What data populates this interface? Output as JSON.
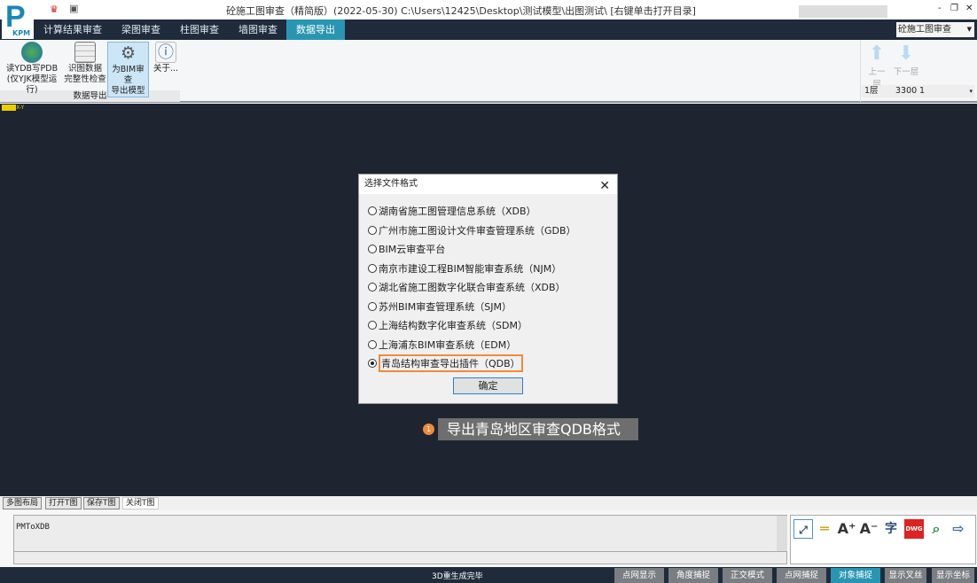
{
  "window": {
    "title": "砼施工图审查（精简版）(2022-05-30) C:\\Users\\12425\\Desktop\\测试模型\\出图测试\\ [右键单击打开目录]",
    "logo_text": "P KPM",
    "minimize": "-",
    "restore": "❐",
    "close": "✕"
  },
  "tabs": [
    {
      "label": "计算结果审查"
    },
    {
      "label": "梁图审查"
    },
    {
      "label": "柱图审查"
    },
    {
      "label": "墙图审查"
    },
    {
      "label": "数据导出",
      "active": true
    }
  ],
  "mode_select": {
    "value": "砼施工图审查"
  },
  "ribbon": {
    "buttons": [
      {
        "label1": "读YDB写PDB",
        "label2": "(仅YJK模型运行)",
        "icon": "globe-icon"
      },
      {
        "label1": "识图数据",
        "label2": "完整性检查",
        "icon": "table-icon"
      },
      {
        "label1": "为BIM审查",
        "label2": "导出模型",
        "icon": "export-gear-icon",
        "selected": true
      },
      {
        "label1": "关于...",
        "label2": "",
        "icon": "info-icon"
      }
    ],
    "group_label": "数据导出",
    "floor_up": "上一层",
    "floor_down": "下一层",
    "floor": {
      "name": "1层",
      "height": "3300",
      "index": "1"
    }
  },
  "canvas": {
    "axis_label": "X-Y"
  },
  "dialog": {
    "title": "选择文件格式",
    "options": [
      "湖南省施工图管理信息系统（XDB）",
      "广州市施工图设计文件审查管理系统（GDB）",
      "BIM云审查平台",
      "南京市建设工程BIM智能审查系统（NJM）",
      "湖北省施工图数字化联合审查系统（XDB）",
      "苏州BIM审查管理系统（SJM）",
      "上海结构数字化审查系统（SDM）",
      "上海浦东BIM审查系统（EDM）",
      "青岛结构审查导出插件（QDB）"
    ],
    "selected_index": 8,
    "ok": "确定"
  },
  "annotation": {
    "number": "1",
    "text": "导出青岛地区审查QDB格式",
    "color": "#f28a3a"
  },
  "bottom_tabs": [
    "多图布局",
    "打开T图",
    "保存T图",
    "关闭T图"
  ],
  "command": {
    "output": "PMToXDB"
  },
  "status": {
    "message": "3D重生成完毕",
    "buttons": [
      {
        "label": "点网显示"
      },
      {
        "label": "角度捕捉"
      },
      {
        "label": "正交模式"
      },
      {
        "label": "点网捕捉"
      },
      {
        "label": "对象捕捉",
        "active": true
      },
      {
        "label": "显示叉丝"
      },
      {
        "label": "显示坐标"
      }
    ]
  }
}
